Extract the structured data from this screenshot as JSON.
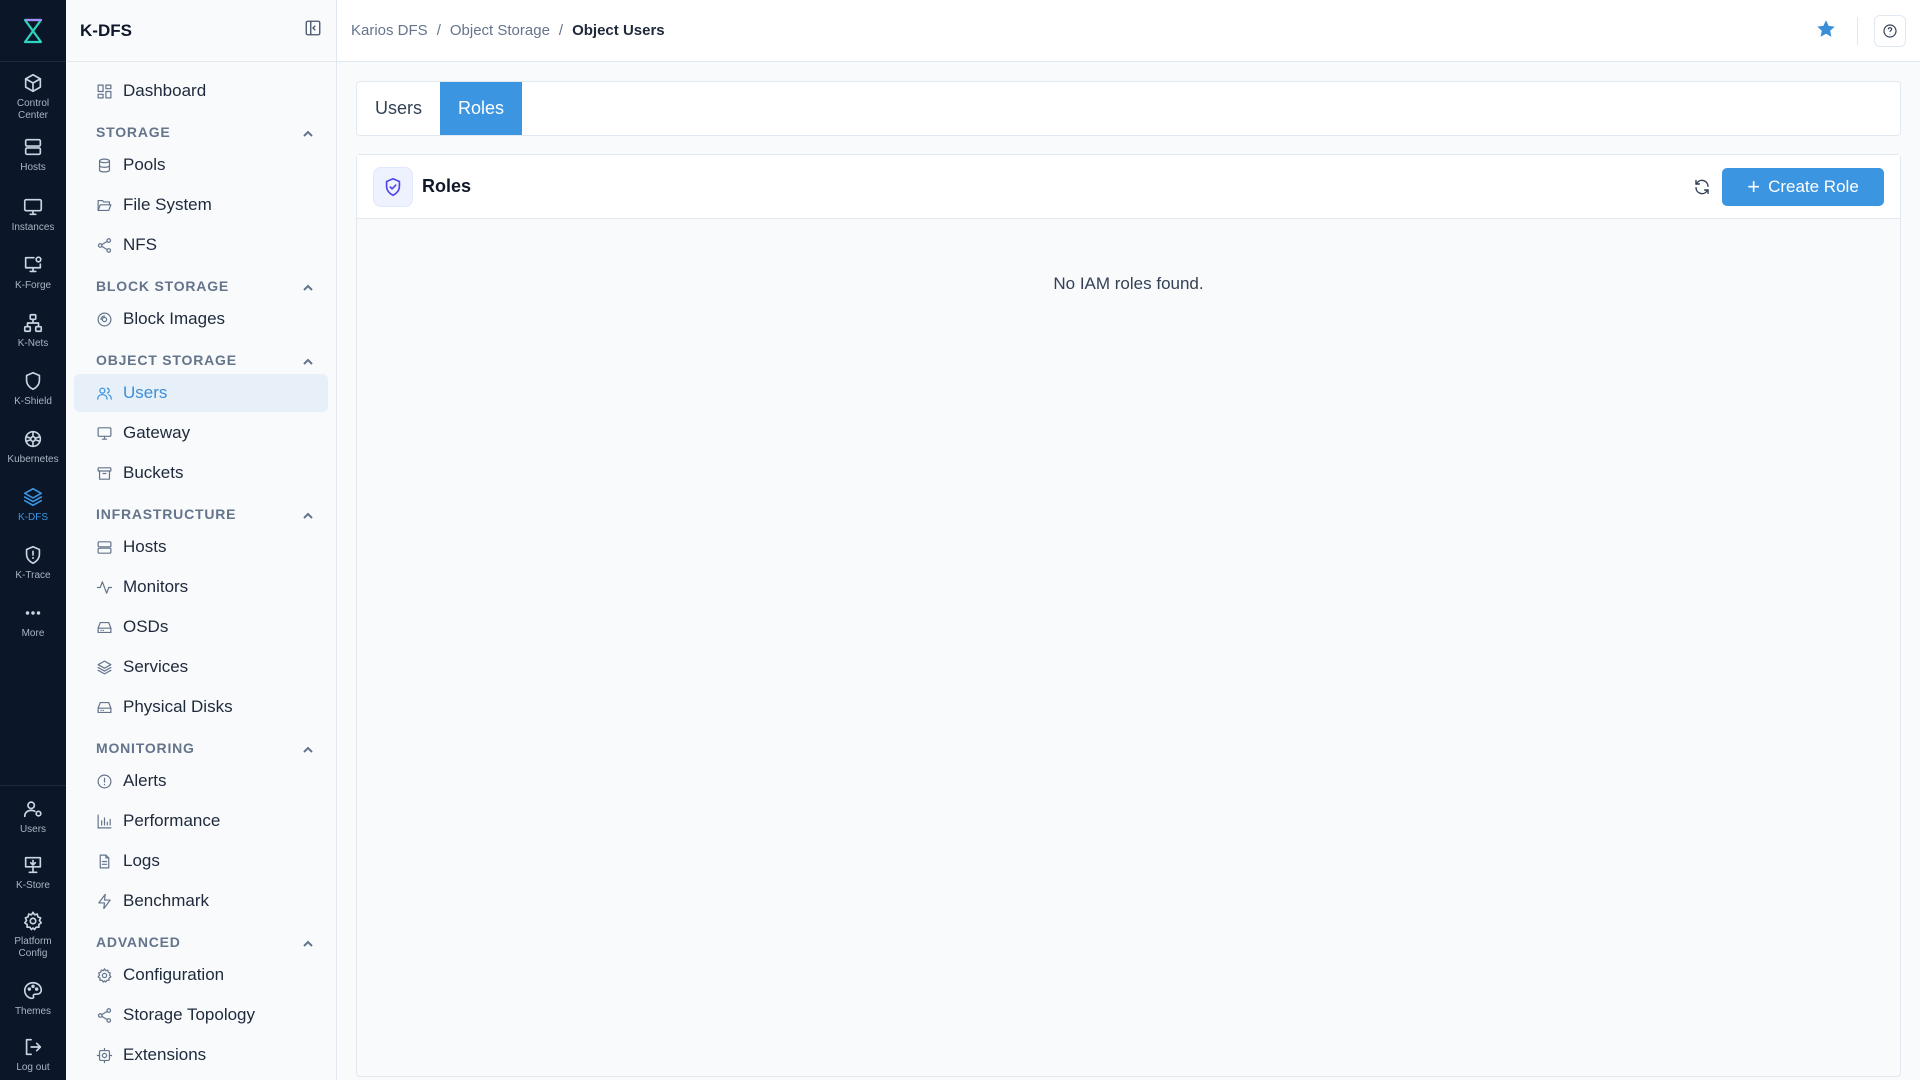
{
  "rail": {
    "items": [
      {
        "label": "Control Center",
        "icon": "cube-icon"
      },
      {
        "label": "Hosts",
        "icon": "server-icon"
      },
      {
        "label": "Instances",
        "icon": "monitor-icon"
      },
      {
        "label": "K-Forge",
        "icon": "monitor-gear-icon"
      },
      {
        "label": "K-Nets",
        "icon": "network-icon"
      },
      {
        "label": "K-Shield",
        "icon": "shield-icon"
      },
      {
        "label": "Kubernetes",
        "icon": "helm-icon"
      },
      {
        "label": "K-DFS",
        "icon": "layers-icon",
        "active": true
      },
      {
        "label": "K-Trace",
        "icon": "shield-alert-icon"
      },
      {
        "label": "More",
        "icon": "ellipsis-icon"
      }
    ],
    "bottom": [
      {
        "label": "Users",
        "icon": "user-gear-icon"
      },
      {
        "label": "K-Store",
        "icon": "store-icon"
      },
      {
        "label": "Platform Config",
        "icon": "gear-icon"
      },
      {
        "label": "Themes",
        "icon": "palette-icon"
      },
      {
        "label": "Log out",
        "icon": "logout-icon"
      }
    ]
  },
  "sidebar": {
    "title": "K-DFS",
    "dashboard": "Dashboard",
    "sections": {
      "storage": {
        "title": "STORAGE",
        "items": [
          "Pools",
          "File System",
          "NFS"
        ]
      },
      "block": {
        "title": "BLOCK STORAGE",
        "items": [
          "Block Images"
        ]
      },
      "object": {
        "title": "OBJECT STORAGE",
        "items": [
          "Users",
          "Gateway",
          "Buckets"
        ]
      },
      "infra": {
        "title": "INFRASTRUCTURE",
        "items": [
          "Hosts",
          "Monitors",
          "OSDs",
          "Services",
          "Physical Disks"
        ]
      },
      "monitoring": {
        "title": "MONITORING",
        "items": [
          "Alerts",
          "Performance",
          "Logs",
          "Benchmark"
        ]
      },
      "advanced": {
        "title": "ADVANCED",
        "items": [
          "Configuration",
          "Storage Topology",
          "Extensions"
        ]
      }
    }
  },
  "breadcrumb": [
    "Karios DFS",
    "Object Storage",
    "Object Users"
  ],
  "tabs": [
    "Users",
    "Roles"
  ],
  "active_tab": "Roles",
  "panel": {
    "title": "Roles",
    "create_label": "Create Role",
    "empty_text": "No IAM roles found."
  },
  "colors": {
    "accent": "#3b95e0",
    "rail_bg": "#0b1629"
  }
}
